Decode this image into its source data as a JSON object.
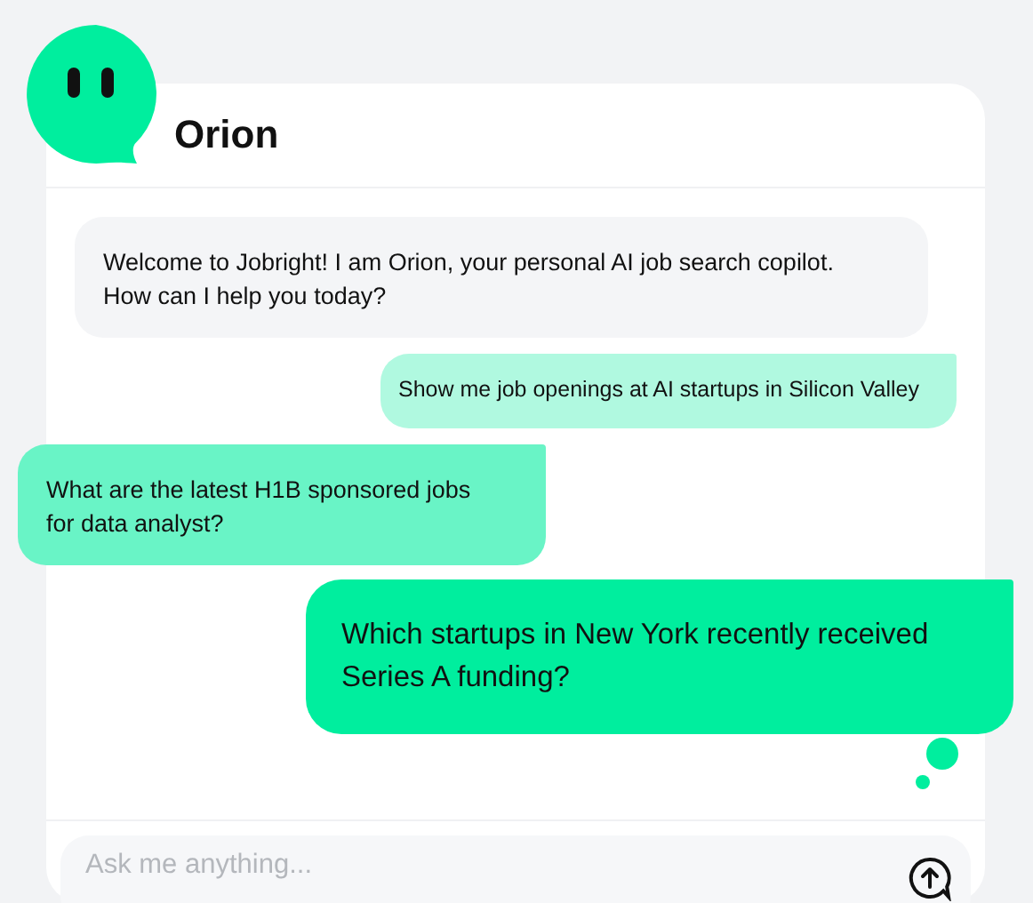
{
  "assistant": {
    "name": "Orion"
  },
  "messages": [
    {
      "kind": "bot",
      "text": "Welcome to Jobright! I am Orion, your personal AI job search copilot. How can I help you today?"
    },
    {
      "kind": "suggestion-right",
      "text": "Show me job openings at AI startups in Silicon Valley"
    },
    {
      "kind": "suggestion-left",
      "text": "What are the latest H1B sponsored jobs for data analyst?"
    },
    {
      "kind": "featured",
      "text": "Which startups in New York recently received Series A funding?"
    }
  ],
  "composer": {
    "placeholder": "Ask me anything..."
  }
}
